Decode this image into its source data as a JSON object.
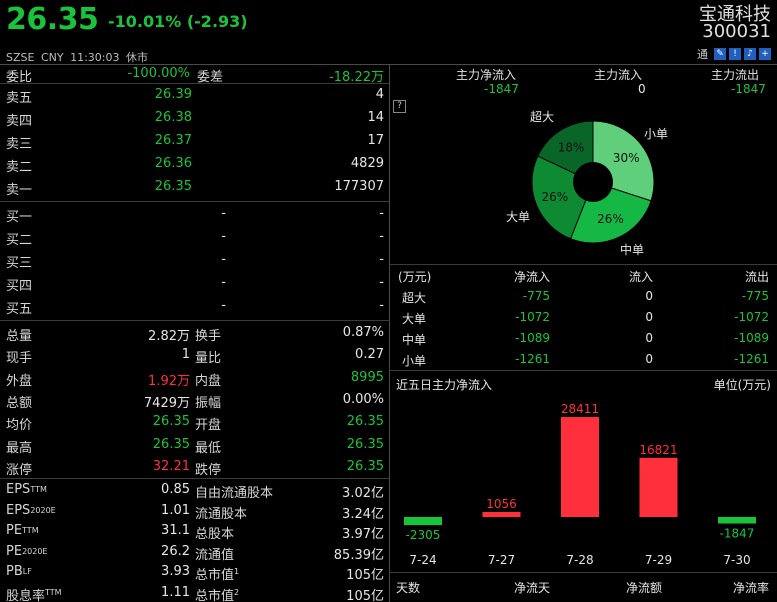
{
  "header": {
    "price": "26.35",
    "change": "-10.01% (-2.93)",
    "exchange": "SZSE",
    "currency": "CNY",
    "time": "11:30:03",
    "status": "休市",
    "name": "宝通科技",
    "code": "300031",
    "tong": "通"
  },
  "weibi": {
    "label": "委比",
    "value": "-100.00%",
    "diff_label": "委差",
    "diff_value": "-18.22万"
  },
  "sell": [
    {
      "label": "卖五",
      "price": "26.39",
      "vol": "4"
    },
    {
      "label": "卖四",
      "price": "26.38",
      "vol": "14"
    },
    {
      "label": "卖三",
      "price": "26.37",
      "vol": "17"
    },
    {
      "label": "卖二",
      "price": "26.36",
      "vol": "4829"
    },
    {
      "label": "卖一",
      "price": "26.35",
      "vol": "177307"
    }
  ],
  "buy": [
    {
      "label": "买一",
      "price": "-",
      "vol": "-"
    },
    {
      "label": "买二",
      "price": "-",
      "vol": "-"
    },
    {
      "label": "买三",
      "price": "-",
      "vol": "-"
    },
    {
      "label": "买四",
      "price": "-",
      "vol": "-"
    },
    {
      "label": "买五",
      "price": "-",
      "vol": "-"
    }
  ],
  "stats": [
    {
      "l1": "总量",
      "v1": "2.82万",
      "l2": "换手",
      "v2": "0.87%"
    },
    {
      "l1": "现手",
      "v1": "1",
      "l2": "量比",
      "v2": "0.27"
    },
    {
      "l1": "外盘",
      "v1": "1.92万",
      "l2": "内盘",
      "v2": "8995"
    },
    {
      "l1": "总额",
      "v1": "7429万",
      "l2": "振幅",
      "v2": "0.00%"
    },
    {
      "l1": "均价",
      "v1": "26.35",
      "l2": "开盘",
      "v2": "26.35"
    },
    {
      "l1": "最高",
      "v1": "26.35",
      "l2": "最低",
      "v2": "26.35"
    },
    {
      "l1": "涨停",
      "v1": "32.21",
      "l2": "跌停",
      "v2": "26.35"
    }
  ],
  "fundamentals": [
    {
      "l1": "EPS",
      "s1": "TTM",
      "v1": "0.85",
      "l2": "自由流通股本",
      "s2": "",
      "v2": "3.02亿"
    },
    {
      "l1": "EPS",
      "s1": "2020E",
      "v1": "1.01",
      "l2": "流通股本",
      "s2": "",
      "v2": "3.24亿"
    },
    {
      "l1": "PE",
      "s1": "TTM",
      "v1": "31.1",
      "l2": "总股本",
      "s2": "",
      "v2": "3.97亿"
    },
    {
      "l1": "PE",
      "s1": "2020E",
      "v1": "26.2",
      "l2": "流通值",
      "s2": "",
      "v2": "85.39亿"
    },
    {
      "l1": "PB",
      "s1": "LF",
      "v1": "3.93",
      "l2": "总市值",
      "s2": "1",
      "v2": "105亿"
    },
    {
      "l1": "股息率",
      "s1": "TTM",
      "v1": "1.11",
      "l2": "总市值",
      "s2": "2",
      "v2": "105亿"
    }
  ],
  "main_flow": {
    "net_label": "主力净流入",
    "net": "-1847",
    "in_label": "主力流入",
    "in": "0",
    "out_label": "主力流出",
    "out": "-1847"
  },
  "pie": {
    "slices": [
      {
        "name": "小单",
        "pct": 30,
        "label": "30%",
        "color": "#5fcf7c"
      },
      {
        "name": "中单",
        "pct": 26,
        "label": "26%",
        "color": "#16b845"
      },
      {
        "name": "大单",
        "pct": 26,
        "label": "26%",
        "color": "#0e8a32"
      },
      {
        "name": "超大",
        "pct": 18,
        "label": "18%",
        "color": "#0a6628"
      }
    ]
  },
  "flow_table": {
    "headers": [
      "(万元)",
      "净流入",
      "流入",
      "流出"
    ],
    "rows": [
      {
        "name": "超大",
        "net": "-775",
        "in": "0",
        "out": "-775"
      },
      {
        "name": "大单",
        "net": "-1072",
        "in": "0",
        "out": "-1072"
      },
      {
        "name": "中单",
        "net": "-1089",
        "in": "0",
        "out": "-1089"
      },
      {
        "name": "小单",
        "net": "-1261",
        "in": "0",
        "out": "-1261"
      }
    ]
  },
  "chart_data": {
    "type": "bar",
    "title": "近五日主力净流入",
    "unit": "单位(万元)",
    "categories": [
      "7-24",
      "7-27",
      "7-28",
      "7-29",
      "7-30"
    ],
    "values": [
      -2305,
      1056,
      28411,
      16821,
      -1847
    ],
    "labels": [
      "-2305",
      "1056",
      "28411",
      "16821",
      "-1847"
    ],
    "colors": {
      "positive": "#ff2f3c",
      "negative": "#19c43a"
    }
  },
  "footer": [
    "天数",
    "净流天",
    "净流额",
    "净流率"
  ]
}
